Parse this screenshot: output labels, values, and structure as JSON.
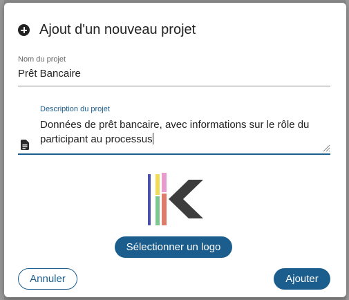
{
  "dialog": {
    "title": "Ajout d'un nouveau projet",
    "title_icon": "plus-circle-icon"
  },
  "form": {
    "name": {
      "label": "Nom du projet",
      "value": "Prêt Bancaire"
    },
    "description": {
      "label": "Description du projet",
      "value": "Données de prêt bancaire, avec informations sur le rôle du participant au processus",
      "icon": "document-icon"
    }
  },
  "logo": {
    "icon": "project-logo",
    "bar_colors": [
      "#4a4fa8",
      "#f1dc55",
      "#e79bd0",
      "#7cc98f",
      "#df7b6a"
    ],
    "k_color": "#3d3d3d"
  },
  "buttons": {
    "select_logo": "Sélectionner un logo",
    "cancel": "Annuler",
    "add": "Ajouter"
  },
  "colors": {
    "accent": "#1b5e8e"
  }
}
